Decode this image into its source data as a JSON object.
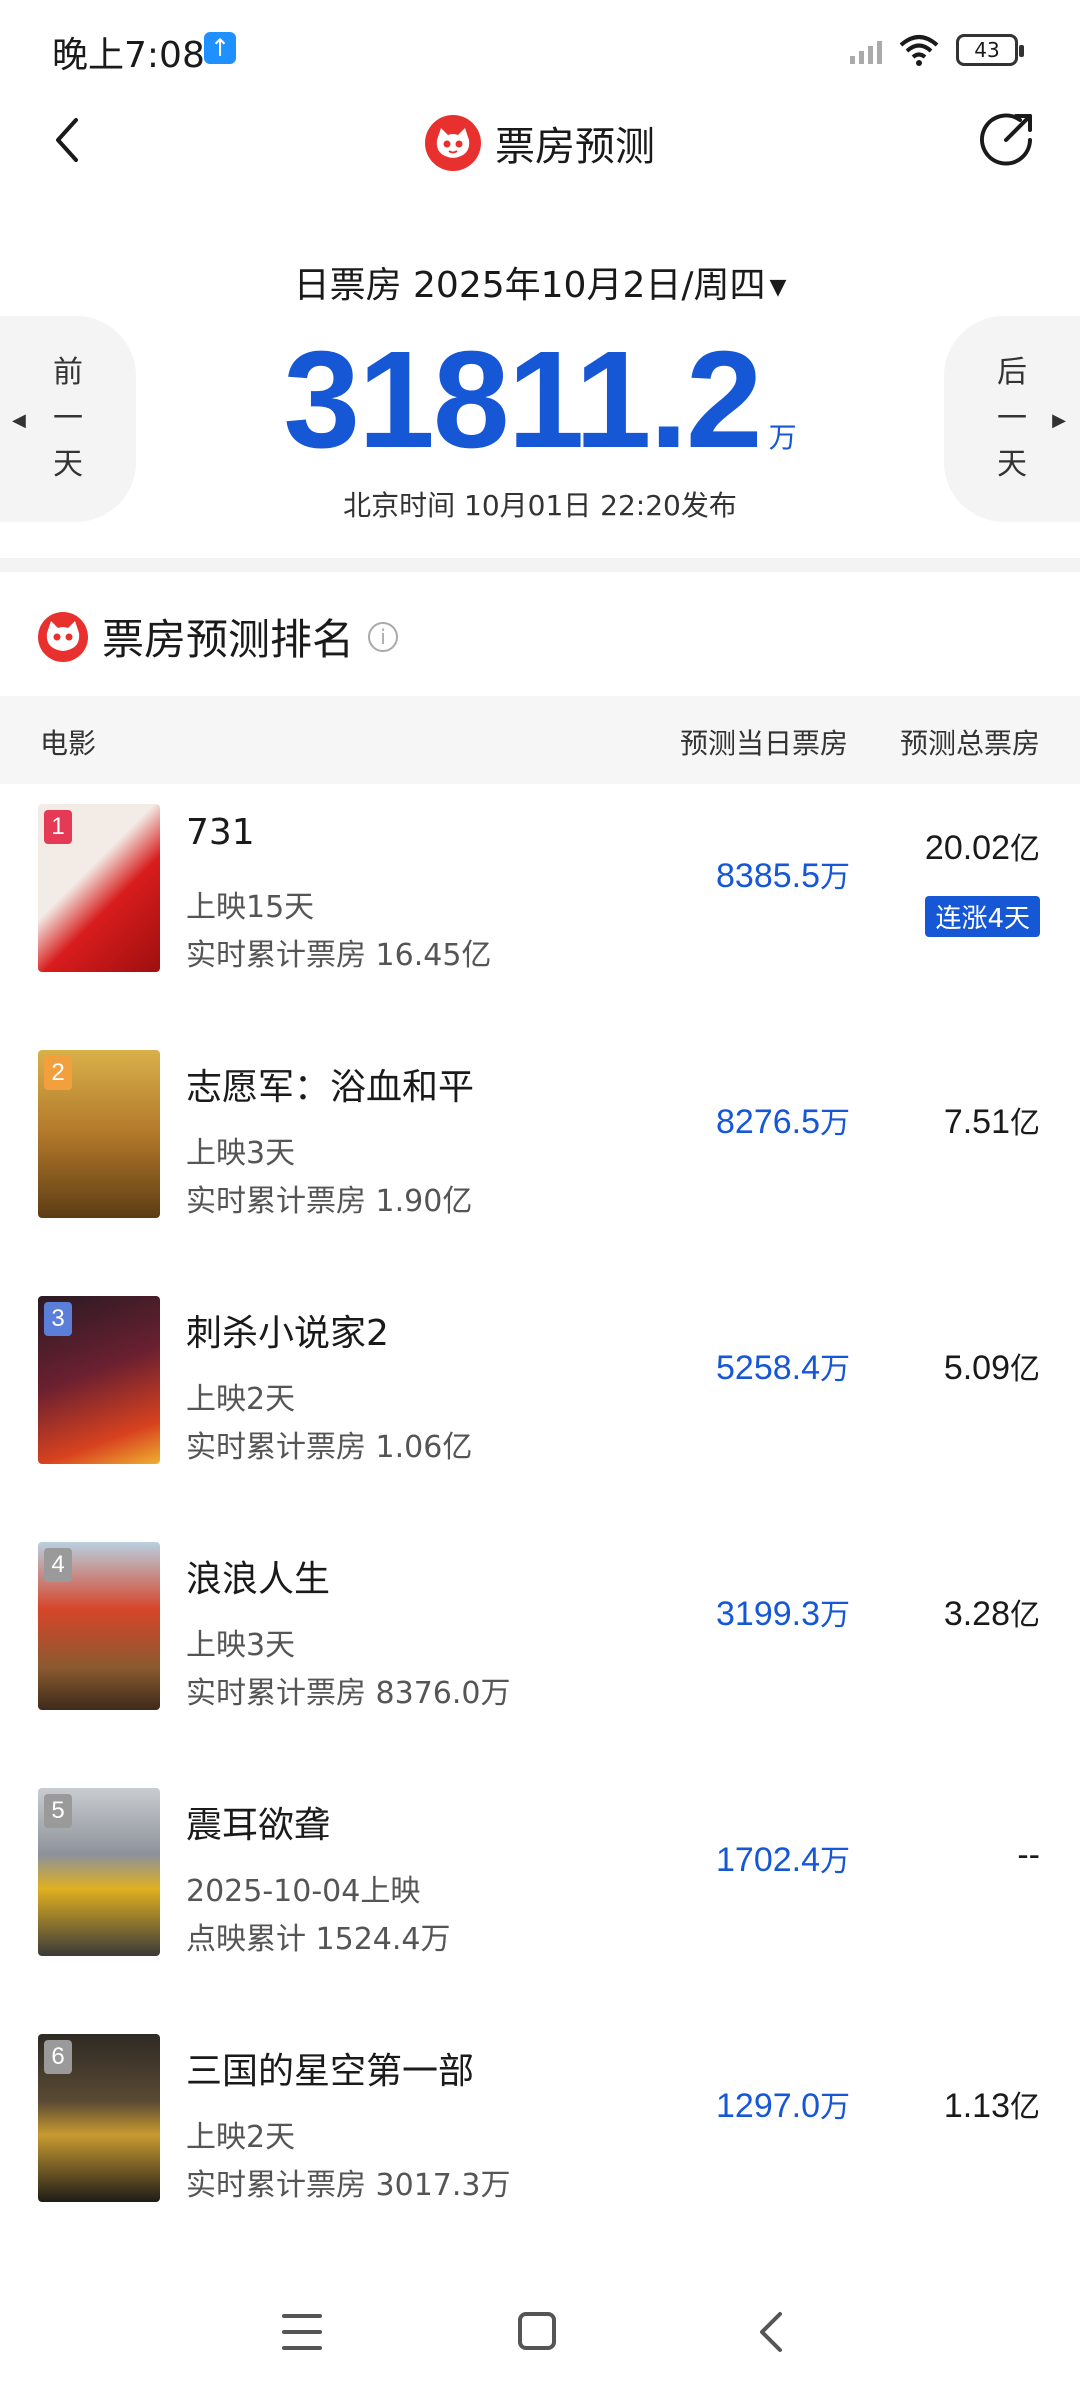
{
  "status": {
    "time": "晚上7:08",
    "battery": "43"
  },
  "header": {
    "title": "票房预测"
  },
  "summary": {
    "date_label": "日票房 2025年10月2日/周四",
    "total": "31811.2",
    "unit": "万",
    "publish": "北京时间  10月01日  22:20发布",
    "prev_label": "前一天",
    "next_label": "后一天"
  },
  "section": {
    "title": "票房预测排名"
  },
  "table_head": {
    "movie": "电影",
    "daily": "预测当日票房",
    "total": "预测总票房"
  },
  "colors": {
    "accent": "#1657d6",
    "brand": "#e8302f"
  },
  "rows": [
    {
      "rank": "1",
      "name": "731",
      "sub1": "上映15天",
      "sub2": "实时累计票房 16.45亿",
      "daily": "8385.5",
      "daily_unit": "万",
      "total": "20.02",
      "total_unit": "亿",
      "badge": "连涨4天"
    },
    {
      "rank": "2",
      "name": "志愿军：浴血和平",
      "sub1": "上映3天",
      "sub2": "实时累计票房 1.90亿",
      "daily": "8276.5",
      "daily_unit": "万",
      "total": "7.51",
      "total_unit": "亿"
    },
    {
      "rank": "3",
      "name": "刺杀小说家2",
      "sub1": "上映2天",
      "sub2": "实时累计票房 1.06亿",
      "daily": "5258.4",
      "daily_unit": "万",
      "total": "5.09",
      "total_unit": "亿"
    },
    {
      "rank": "4",
      "name": "浪浪人生",
      "sub1": "上映3天",
      "sub2": "实时累计票房 8376.0万",
      "daily": "3199.3",
      "daily_unit": "万",
      "total": "3.28",
      "total_unit": "亿"
    },
    {
      "rank": "5",
      "name": "震耳欲聋",
      "sub1": "2025-10-04上映",
      "sub2": "点映累计 1524.4万",
      "daily": "1702.4",
      "daily_unit": "万",
      "total": "--",
      "total_unit": ""
    },
    {
      "rank": "6",
      "name": "三国的星空第一部",
      "sub1": "上映2天",
      "sub2": "实时累计票房 3017.3万",
      "daily": "1297.0",
      "daily_unit": "万",
      "total": "1.13",
      "total_unit": "亿"
    }
  ]
}
